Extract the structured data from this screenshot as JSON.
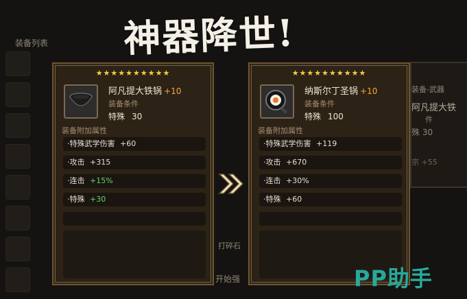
{
  "title_art": "神器降世!",
  "background": {
    "list_label": "装备列表",
    "right_partial_1": "装备-武器",
    "right_partial_2": "阿凡提大铁",
    "right_partial_3": "件",
    "right_partial_4": "殊 30",
    "right_partial_5": "宗 +55",
    "bottom_label_1": "打碎石",
    "bottom_label_2": "开始强"
  },
  "left_card": {
    "stars": "★★★★★★★★★★",
    "name": "阿凡提大铁锅",
    "plus": "+10",
    "req_label": "装备条件",
    "req_type": "特殊",
    "req_value": "30",
    "attr_title": "装备附加属性",
    "attrs": [
      {
        "label": "·特殊武学伤害",
        "value": "+60",
        "color": "normal"
      },
      {
        "label": "·攻击",
        "value": "+315",
        "color": "normal"
      },
      {
        "label": "·连击",
        "value": "+15%",
        "color": "green"
      },
      {
        "label": "·特殊",
        "value": "+30",
        "color": "green"
      }
    ]
  },
  "right_card": {
    "stars": "★★★★★★★★★★",
    "name": "纳斯尔丁圣锅",
    "plus": "+10",
    "req_label": "装备条件",
    "req_type": "特殊",
    "req_value": "100",
    "attr_title": "装备附加属性",
    "attrs": [
      {
        "label": "·特殊武学伤害",
        "value": "+119"
      },
      {
        "label": "·攻击",
        "value": "+670"
      },
      {
        "label": "·连击",
        "value": "+30%"
      },
      {
        "label": "·特殊",
        "value": "+60"
      }
    ]
  },
  "watermark": "PP助手",
  "colors": {
    "star": "#f2cf3d",
    "plus": "#f6a83c",
    "green": "#5fd86a",
    "watermark": "#26a99b"
  }
}
